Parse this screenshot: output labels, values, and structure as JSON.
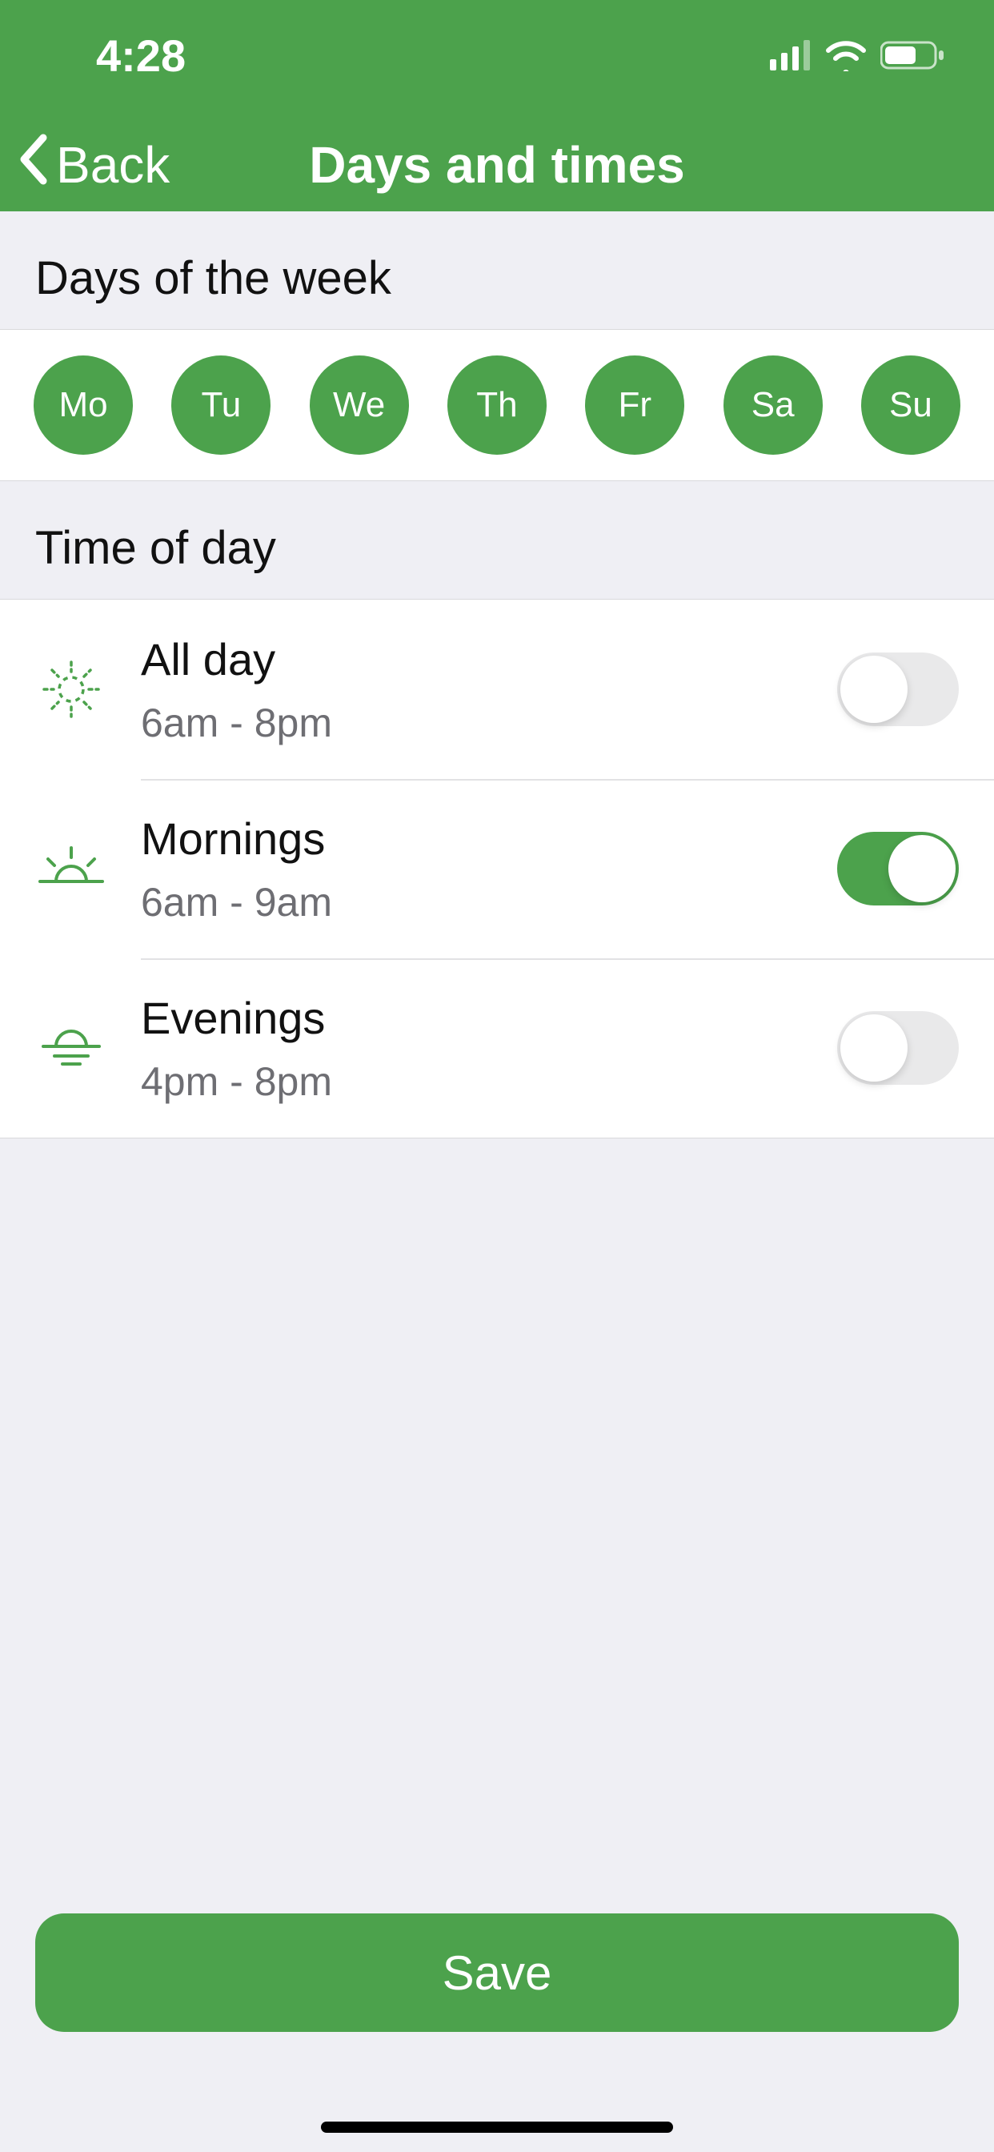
{
  "status": {
    "time": "4:28"
  },
  "nav": {
    "back_label": "Back",
    "title": "Days and times"
  },
  "sections": {
    "days_header": "Days of the week",
    "time_header": "Time of day"
  },
  "days": [
    {
      "abbr": "Mo",
      "selected": true
    },
    {
      "abbr": "Tu",
      "selected": true
    },
    {
      "abbr": "We",
      "selected": true
    },
    {
      "abbr": "Th",
      "selected": true
    },
    {
      "abbr": "Fr",
      "selected": true
    },
    {
      "abbr": "Sa",
      "selected": true
    },
    {
      "abbr": "Su",
      "selected": true
    }
  ],
  "time_options": [
    {
      "title": "All day",
      "subtitle": "6am - 8pm",
      "icon": "sun-icon",
      "enabled": false
    },
    {
      "title": "Mornings",
      "subtitle": "6am - 9am",
      "icon": "sunrise-icon",
      "enabled": true
    },
    {
      "title": "Evenings",
      "subtitle": "4pm - 8pm",
      "icon": "sunset-icon",
      "enabled": false
    }
  ],
  "actions": {
    "save_label": "Save"
  },
  "colors": {
    "primary": "#4CA24C",
    "background": "#EFEFF4"
  }
}
